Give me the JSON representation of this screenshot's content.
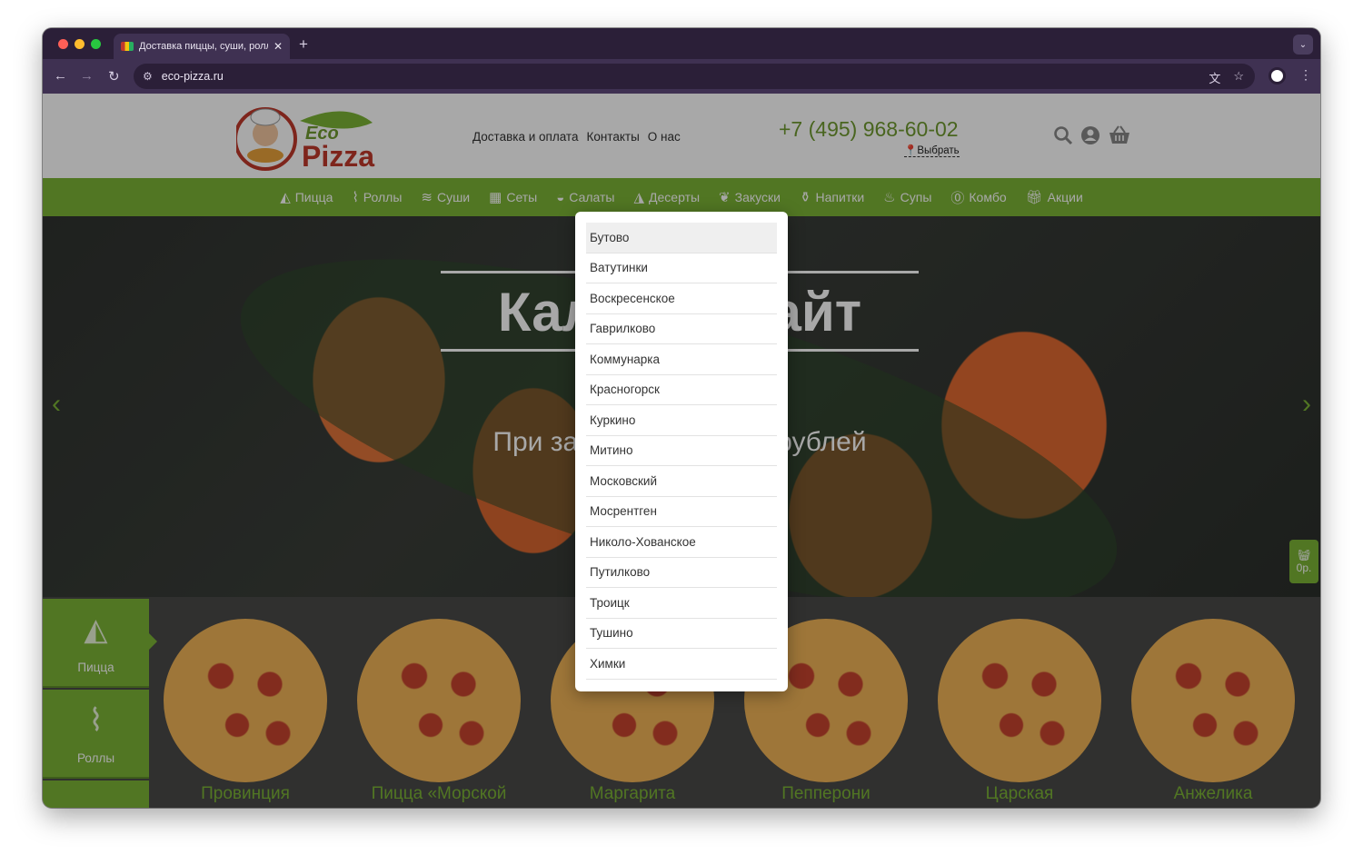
{
  "browser": {
    "tab_title": "Доставка пиццы, суши, ролл",
    "url": "eco-pizza.ru"
  },
  "header": {
    "logo_text_top": "Eco",
    "logo_text_bottom": "Pizza",
    "links": [
      "Доставка и оплата",
      "Контакты",
      "О нас"
    ],
    "phone": "+7 (495) 968-60-02",
    "choose_label": "Выбрать"
  },
  "categories": [
    {
      "label": "Пицца",
      "icon": "pizza-icon"
    },
    {
      "label": "Роллы",
      "icon": "rolls-icon"
    },
    {
      "label": "Суши",
      "icon": "sushi-icon"
    },
    {
      "label": "Сеты",
      "icon": "sets-icon"
    },
    {
      "label": "Салаты",
      "icon": "salad-icon"
    },
    {
      "label": "Десерты",
      "icon": "dessert-icon"
    },
    {
      "label": "Закуски",
      "icon": "snacks-icon"
    },
    {
      "label": "Напитки",
      "icon": "drinks-icon"
    },
    {
      "label": "Супы",
      "icon": "soup-icon"
    },
    {
      "label": "Комбо",
      "icon": "combo-icon"
    },
    {
      "label": "Акции",
      "icon": "gift-icon"
    }
  ],
  "hero": {
    "title_left": "Кали",
    "title_right": "лайт",
    "subtitle_left": "При заказ",
    "subtitle_right": "00 рублей"
  },
  "cart_float": {
    "amount": "0р."
  },
  "side_tabs": [
    "Пицца",
    "Роллы"
  ],
  "products": [
    "Провинция",
    "Пицца «Морской",
    "Маргарита",
    "Пепперони",
    "Царская",
    "Анжелика"
  ],
  "dropdown": {
    "items": [
      "Бутово",
      "Ватутинки",
      "Воскресенское",
      "Гаврилково",
      "Коммунарка",
      "Красногорск",
      "Куркино",
      "Митино",
      "Московский",
      "Мосрентген",
      "Николо-Хованское",
      "Путилково",
      "Троицк",
      "Тушино",
      "Химки"
    ],
    "selected_index": 0
  },
  "colors": {
    "brand_green": "#7bb336",
    "phone_green": "#6f9a30"
  }
}
